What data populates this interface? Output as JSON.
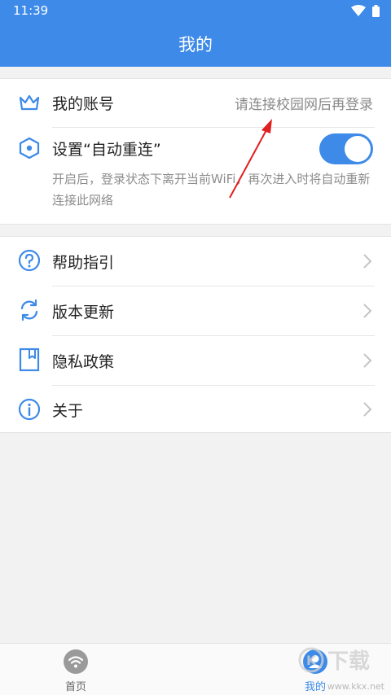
{
  "status_bar": {
    "time": "11:39"
  },
  "header": {
    "title": "我的"
  },
  "account": {
    "label": "我的账号",
    "hint": "请连接校园网后再登录",
    "icon": "crown-icon"
  },
  "auto_reconnect": {
    "label": "设置“自动重连”",
    "description": "开启后，登录状态下离开当前WiFi，再次进入时将自动重新连接此网络",
    "enabled": true,
    "icon": "hexagon-icon"
  },
  "menu": [
    {
      "label": "帮助指引",
      "icon": "help-icon"
    },
    {
      "label": "版本更新",
      "icon": "refresh-icon"
    },
    {
      "label": "隐私政策",
      "icon": "bookmark-icon"
    },
    {
      "label": "关于",
      "icon": "info-icon"
    }
  ],
  "tabbar": {
    "tabs": [
      {
        "label": "首页",
        "icon": "wifi-icon",
        "active": false
      },
      {
        "label": "我的",
        "icon": "user-icon",
        "active": true
      }
    ]
  },
  "watermark": {
    "text": "www.kkx.net",
    "logo_text": "K下载"
  },
  "colors": {
    "accent": "#3d8ae8",
    "annotation_arrow": "#e02020"
  }
}
